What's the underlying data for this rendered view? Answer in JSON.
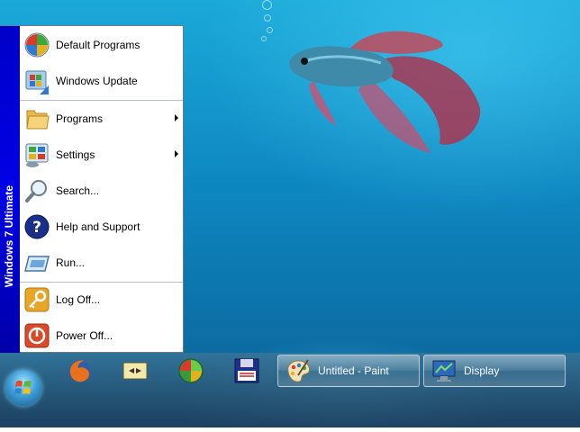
{
  "start_menu": {
    "banner": "Windows 7 Ultimate",
    "items": [
      {
        "label": "Default Programs",
        "icon": "default-programs-icon",
        "submenu": false
      },
      {
        "label": "Windows Update",
        "icon": "windows-update-icon",
        "submenu": false
      },
      {
        "label": "Programs",
        "icon": "folder-icon",
        "submenu": true
      },
      {
        "label": "Settings",
        "icon": "control-panel-icon",
        "submenu": true
      },
      {
        "label": "Search...",
        "icon": "search-icon",
        "submenu": false
      },
      {
        "label": "Help and Support",
        "icon": "help-icon",
        "submenu": false
      },
      {
        "label": "Run...",
        "icon": "run-icon",
        "submenu": false
      },
      {
        "label": "Log Off...",
        "icon": "key-icon",
        "submenu": false
      },
      {
        "label": "Power Off...",
        "icon": "power-icon",
        "submenu": false
      }
    ]
  },
  "taskbar": {
    "start_button_icon": "windows-orb-icon",
    "quick_launch": [
      {
        "icon": "firefox-icon"
      },
      {
        "icon": "mouse-settings-icon"
      },
      {
        "icon": "windows-logo-icon"
      },
      {
        "icon": "floppy-disk-icon"
      }
    ],
    "tasks": [
      {
        "label": "Untitled - Paint",
        "icon": "paint-palette-icon"
      },
      {
        "label": "Display",
        "icon": "display-monitor-icon"
      }
    ]
  }
}
